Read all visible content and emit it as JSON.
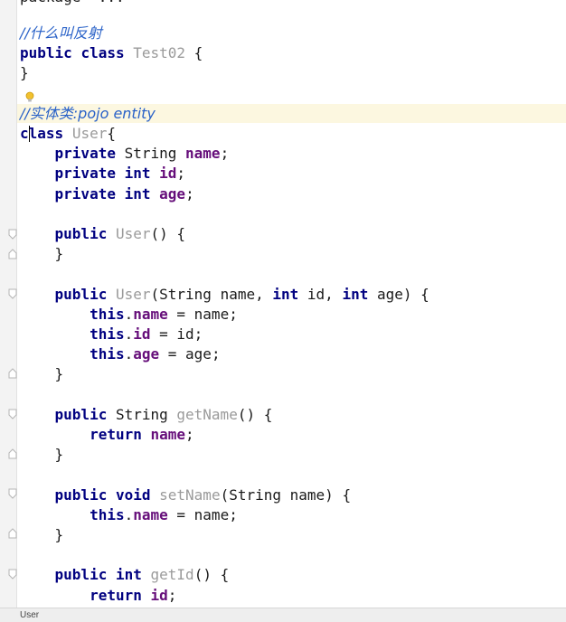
{
  "editor": {
    "partial_top_line": "package  ...",
    "lines": [
      {
        "tokens": [
          {
            "t": "//什么叫反射",
            "c": "cmt"
          }
        ]
      },
      {
        "tokens": [
          {
            "t": "public",
            "c": "kw"
          },
          {
            "t": " "
          },
          {
            "t": "class",
            "c": "kw"
          },
          {
            "t": " "
          },
          {
            "t": "Test02",
            "c": "cls"
          },
          {
            "t": " {"
          }
        ]
      },
      {
        "tokens": [
          {
            "t": "}"
          }
        ]
      },
      {
        "tokens": []
      },
      {
        "tokens": [
          {
            "t": "//实体类:pojo entity",
            "c": "cmt"
          }
        ]
      },
      {
        "tokens": [
          {
            "t": "class",
            "c": "kw"
          },
          {
            "t": " "
          },
          {
            "t": "User",
            "c": "cls"
          },
          {
            "t": "{"
          }
        ]
      },
      {
        "tokens": [
          {
            "t": "    "
          },
          {
            "t": "private",
            "c": "kw"
          },
          {
            "t": " String "
          },
          {
            "t": "name",
            "c": "fld"
          },
          {
            "t": ";"
          }
        ]
      },
      {
        "tokens": [
          {
            "t": "    "
          },
          {
            "t": "private",
            "c": "kw"
          },
          {
            "t": " "
          },
          {
            "t": "int",
            "c": "kw"
          },
          {
            "t": " "
          },
          {
            "t": "id",
            "c": "fld"
          },
          {
            "t": ";"
          }
        ]
      },
      {
        "tokens": [
          {
            "t": "    "
          },
          {
            "t": "private",
            "c": "kw"
          },
          {
            "t": " "
          },
          {
            "t": "int",
            "c": "kw"
          },
          {
            "t": " "
          },
          {
            "t": "age",
            "c": "fld"
          },
          {
            "t": ";"
          }
        ]
      },
      {
        "tokens": []
      },
      {
        "tokens": [
          {
            "t": "    "
          },
          {
            "t": "public",
            "c": "kw"
          },
          {
            "t": " "
          },
          {
            "t": "User",
            "c": "cls"
          },
          {
            "t": "() {"
          }
        ]
      },
      {
        "tokens": [
          {
            "t": "    }"
          }
        ]
      },
      {
        "tokens": []
      },
      {
        "tokens": [
          {
            "t": "    "
          },
          {
            "t": "public",
            "c": "kw"
          },
          {
            "t": " "
          },
          {
            "t": "User",
            "c": "cls"
          },
          {
            "t": "(String name, "
          },
          {
            "t": "int",
            "c": "kw"
          },
          {
            "t": " id, "
          },
          {
            "t": "int",
            "c": "kw"
          },
          {
            "t": " age) {"
          }
        ]
      },
      {
        "tokens": [
          {
            "t": "        "
          },
          {
            "t": "this",
            "c": "kw"
          },
          {
            "t": "."
          },
          {
            "t": "name",
            "c": "fld"
          },
          {
            "t": " = name;"
          }
        ]
      },
      {
        "tokens": [
          {
            "t": "        "
          },
          {
            "t": "this",
            "c": "kw"
          },
          {
            "t": "."
          },
          {
            "t": "id",
            "c": "fld"
          },
          {
            "t": " = id;"
          }
        ]
      },
      {
        "tokens": [
          {
            "t": "        "
          },
          {
            "t": "this",
            "c": "kw"
          },
          {
            "t": "."
          },
          {
            "t": "age",
            "c": "fld"
          },
          {
            "t": " = age;"
          }
        ]
      },
      {
        "tokens": [
          {
            "t": "    }"
          }
        ]
      },
      {
        "tokens": []
      },
      {
        "tokens": [
          {
            "t": "    "
          },
          {
            "t": "public",
            "c": "kw"
          },
          {
            "t": " String "
          },
          {
            "t": "getName",
            "c": "cls"
          },
          {
            "t": "() {"
          }
        ]
      },
      {
        "tokens": [
          {
            "t": "        "
          },
          {
            "t": "return",
            "c": "kw"
          },
          {
            "t": " "
          },
          {
            "t": "name",
            "c": "fld"
          },
          {
            "t": ";"
          }
        ]
      },
      {
        "tokens": [
          {
            "t": "    }"
          }
        ]
      },
      {
        "tokens": []
      },
      {
        "tokens": [
          {
            "t": "    "
          },
          {
            "t": "public",
            "c": "kw"
          },
          {
            "t": " "
          },
          {
            "t": "void",
            "c": "kw"
          },
          {
            "t": " "
          },
          {
            "t": "setName",
            "c": "cls"
          },
          {
            "t": "(String name) {"
          }
        ]
      },
      {
        "tokens": [
          {
            "t": "        "
          },
          {
            "t": "this",
            "c": "kw"
          },
          {
            "t": "."
          },
          {
            "t": "name",
            "c": "fld"
          },
          {
            "t": " = name;"
          }
        ]
      },
      {
        "tokens": [
          {
            "t": "    }"
          }
        ]
      },
      {
        "tokens": []
      },
      {
        "tokens": [
          {
            "t": "    "
          },
          {
            "t": "public",
            "c": "kw"
          },
          {
            "t": " "
          },
          {
            "t": "int",
            "c": "kw"
          },
          {
            "t": " "
          },
          {
            "t": "getId",
            "c": "cls"
          },
          {
            "t": "() {"
          }
        ]
      },
      {
        "tokens": [
          {
            "t": "        "
          },
          {
            "t": "return",
            "c": "kw"
          },
          {
            "t": " "
          },
          {
            "t": "id",
            "c": "fld"
          },
          {
            "t": ";"
          }
        ]
      }
    ]
  },
  "statusbar": {
    "breadcrumb": "User"
  },
  "colors": {
    "keyword": "#000080",
    "field": "#660e7a",
    "comment": "#2a62c8",
    "identifier_gray": "#9a9a9a",
    "caret_line": "#fcf7e0"
  },
  "icons": {
    "intention": "lightbulb-icon",
    "fold": "fold-marker-icon"
  }
}
